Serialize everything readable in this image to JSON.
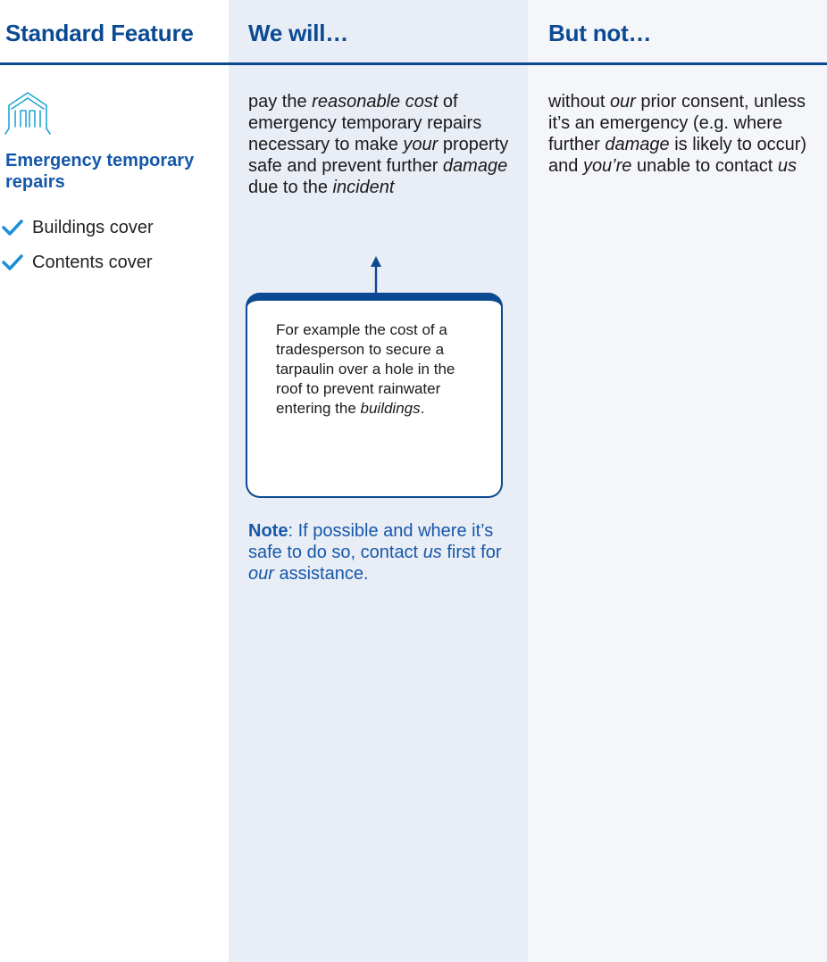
{
  "headers": {
    "feature": "Standard Feature",
    "will": "We will…",
    "not": "But not…"
  },
  "feature": {
    "icon": "house-outline-icon",
    "title": "Emergency temporary repairs",
    "covers": [
      "Buildings cover",
      "Contents cover"
    ],
    "check_icon": "check-icon"
  },
  "will": {
    "segments": [
      {
        "text": "pay the "
      },
      {
        "text": "reasonable cost",
        "italic": true
      },
      {
        "text": " of emergency temporary repairs necessary to make "
      },
      {
        "text": "your",
        "italic": true
      },
      {
        "text": " property safe and prevent further "
      },
      {
        "text": "damage",
        "italic": true
      },
      {
        "text": " due to the "
      },
      {
        "text": "incident",
        "italic": true
      }
    ],
    "example": {
      "segments": [
        {
          "text": "For example the cost of a tradesperson to secure a tarpaulin over a hole in the roof to prevent rainwater entering the "
        },
        {
          "text": "buildings",
          "italic": true
        },
        {
          "text": "."
        }
      ]
    },
    "note": {
      "label": "Note",
      "segments": [
        {
          "text": ": If possible and where it’s safe to do so, contact "
        },
        {
          "text": "us",
          "italic": true
        },
        {
          "text": " first for "
        },
        {
          "text": "our",
          "italic": true
        },
        {
          "text": " assistance."
        }
      ]
    }
  },
  "not": {
    "segments": [
      {
        "text": "without "
      },
      {
        "text": "our",
        "italic": true
      },
      {
        "text": " prior consent, unless it’s an emergency (e.g. where further "
      },
      {
        "text": "damage",
        "italic": true
      },
      {
        "text": " is likely to occur) and "
      },
      {
        "text": "you’re",
        "italic": true
      },
      {
        "text": " unable to contact "
      },
      {
        "text": "us",
        "italic": true
      }
    ]
  },
  "colors": {
    "primary": "#0b4a92",
    "accent": "#1558aa",
    "check": "#1a8fd6",
    "icon": "#22a6d6",
    "will_bg": "#e9edf5",
    "not_bg": "#f4f6f9"
  }
}
